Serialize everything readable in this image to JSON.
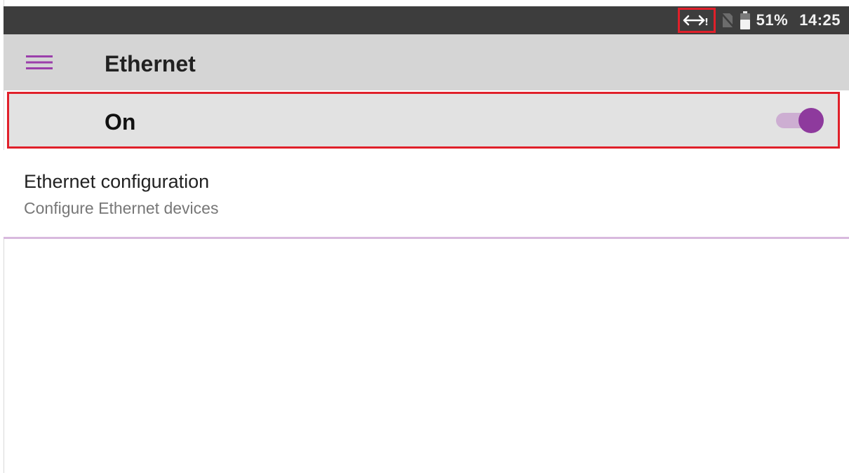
{
  "status_bar": {
    "ethernet_icon": "ethernet-status-icon",
    "sim_icon": "no-sim-icon",
    "battery_icon": "battery-icon",
    "battery_percent": "51%",
    "time": "14:25"
  },
  "toolbar": {
    "menu_icon": "hamburger-menu-icon",
    "title": "Ethernet"
  },
  "master_switch": {
    "label": "On",
    "state": "on"
  },
  "preferences": {
    "items": [
      {
        "title": "Ethernet configuration",
        "summary": "Configure Ethernet devices"
      }
    ]
  },
  "colors": {
    "accent": "#8e3a9d",
    "accent_track": "#cdaed2",
    "highlight_box": "#e0202a",
    "status_bar": "#3d3d3d",
    "toolbar": "#d5d5d5"
  }
}
